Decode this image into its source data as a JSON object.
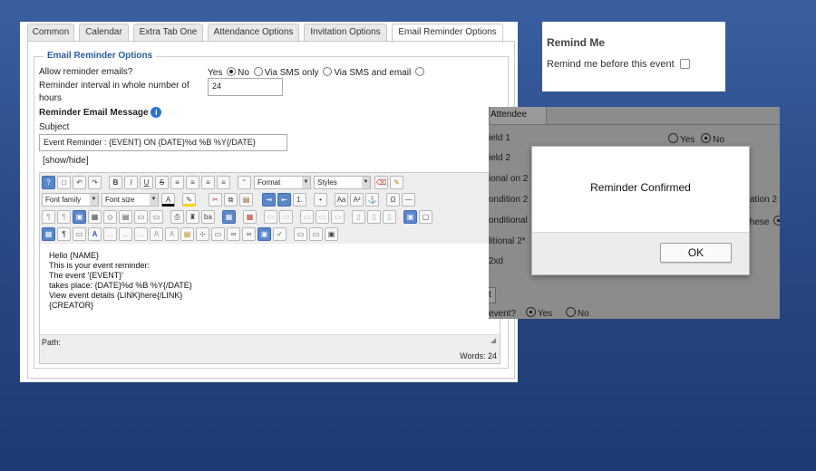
{
  "tabs": [
    "Common",
    "Calendar",
    "Extra Tab One",
    "Attendance Options",
    "Invitation Options",
    "Email Reminder Options"
  ],
  "reminder": {
    "legend": "Email Reminder Options",
    "allow_label": "Allow reminder emails?",
    "opt_yes": "Yes",
    "opt_no": "No",
    "opt_sms": "Via SMS only",
    "opt_sms_email": "Via SMS and email",
    "interval_label": "Reminder interval in whole number of hours",
    "interval_value": "24",
    "message_heading": "Reminder Email Message",
    "subject_label": "Subject",
    "subject_value": "Event Reminder : {EVENT} ON {DATE}%d %B %Y{/DATE}",
    "show_hide": "[show/hide]"
  },
  "editor": {
    "format_select": "Format",
    "styles_select": "Styles",
    "font_family_select": "Font family",
    "font_size_select": "Font size",
    "content_lines": [
      "Hello {NAME}",
      "This is your event reminder:",
      "The event '{EVENT}'",
      "takes place: {DATE}%d %B %Y{/DATE}",
      "View event details {LINK}here{/LINK}",
      "{CREATOR}"
    ],
    "path_label": "Path:",
    "word_count": "Words: 24"
  },
  "remind_me": {
    "title": "Remind Me",
    "checkbox_label": "Remind me before this event"
  },
  "attendee": {
    "tab_label": "Attendee",
    "rows": [
      "ield 1",
      "ield 2",
      "ional on 2",
      "ondition 2",
      "onditional",
      "litional 2*",
      "2xd"
    ],
    "right_yes": "Yes",
    "right_no": "No",
    "right_frag_1": "ation 2",
    "right_frag_2": "these",
    "question": "event?",
    "q_yes": "Yes",
    "q_no": "No",
    "button_frag": "t"
  },
  "dialog": {
    "message": "Reminder Confirmed",
    "ok_label": "OK"
  }
}
